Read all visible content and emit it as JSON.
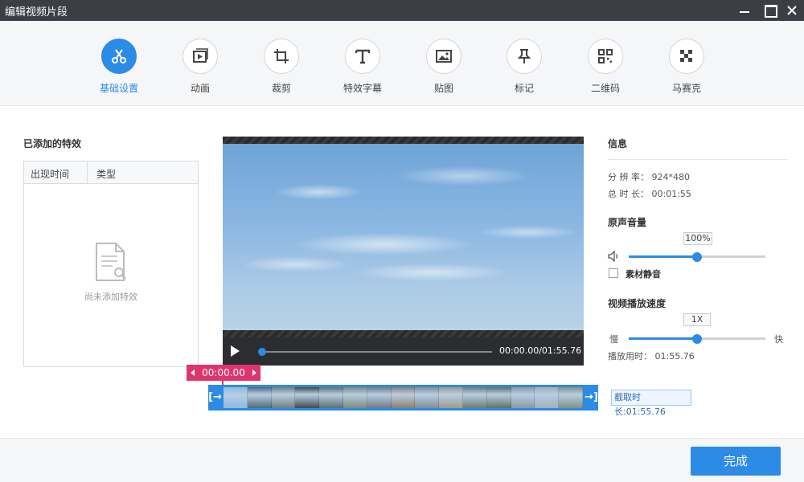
{
  "window": {
    "title": "编辑视频片段"
  },
  "toolbar": {
    "items": [
      {
        "label": "基础设置",
        "icon": "scissors-icon",
        "active": true
      },
      {
        "label": "动画",
        "icon": "animation-icon"
      },
      {
        "label": "裁剪",
        "icon": "crop-icon"
      },
      {
        "label": "特效字幕",
        "icon": "text-icon"
      },
      {
        "label": "贴图",
        "icon": "image-icon"
      },
      {
        "label": "标记",
        "icon": "pin-icon"
      },
      {
        "label": "二维码",
        "icon": "qrcode-icon"
      },
      {
        "label": "马赛克",
        "icon": "mosaic-icon"
      }
    ]
  },
  "effects": {
    "title": "已添加的特效",
    "columns": [
      "出现时间",
      "类型"
    ],
    "empty_text": "尚未添加特效"
  },
  "player": {
    "time": "00:00.00/01:55.76",
    "progress": 0
  },
  "timeline": {
    "marker_time": "00:00.00",
    "handle_left": "[→",
    "handle_right": "→]",
    "cut_duration": "截取时长:01:55.76",
    "frame_colors": [
      "#8fb9e3",
      "#4e6b7a",
      "#6d7f83",
      "#3f4a50",
      "#5a6f73",
      "#7a8a7e",
      "#6e7a86",
      "#8a7f70",
      "#7f8f99",
      "#a09a8c",
      "#6b7c7a",
      "#5e7266",
      "#8a9aa4",
      "#9fb0bd",
      "#7f9286"
    ]
  },
  "info": {
    "title": "信息",
    "resolution_label": "分 辨 率：",
    "resolution": "924*480",
    "duration_label": "总 时 长：",
    "duration": "00:01:55"
  },
  "volume": {
    "title": "原声音量",
    "value_text": "100%",
    "level": 0.5,
    "mute_label": "素材静音"
  },
  "speed": {
    "title": "视频播放速度",
    "value_text": "1X",
    "slow": "慢",
    "fast": "快",
    "level": 0.5,
    "play_time_label": "播放用时：",
    "play_time": "01:55.76"
  },
  "footer": {
    "done_label": "完成"
  },
  "colors": {
    "accent": "#2c8be4",
    "marker": "#e0356c"
  }
}
